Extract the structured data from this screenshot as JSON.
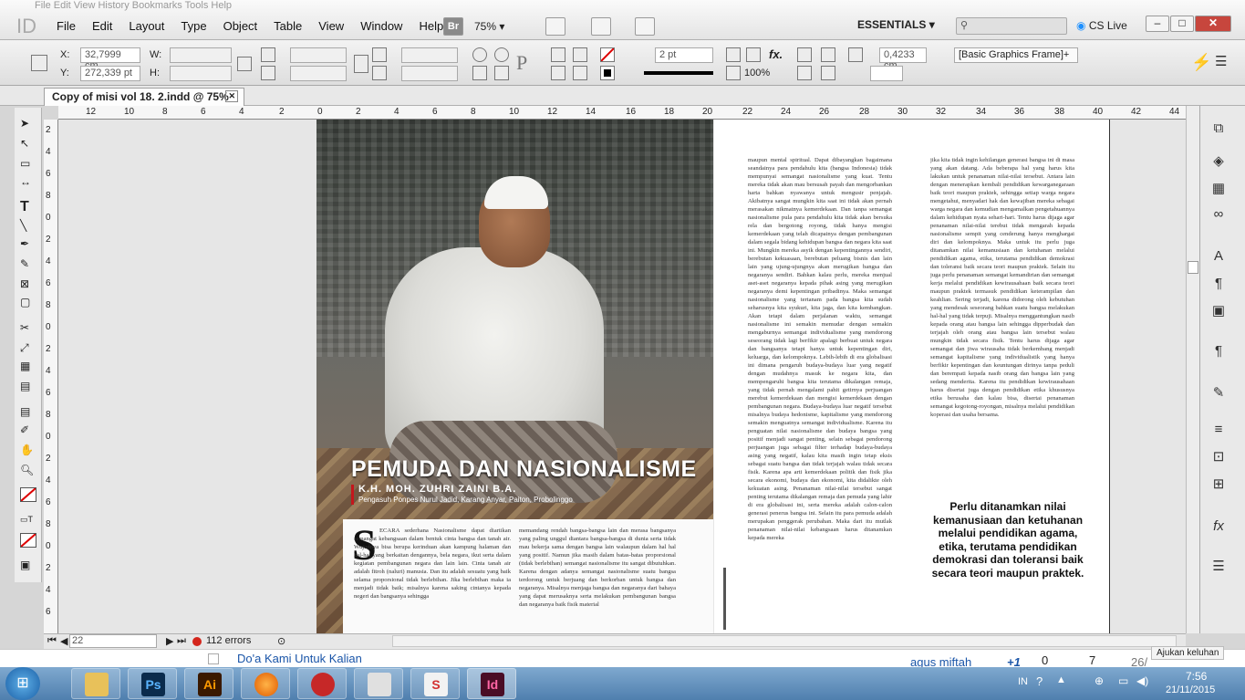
{
  "menubar": {
    "ghost_menu": "File   Edit   View   History   Bookmarks   Tools   Help",
    "app_logo": "ID",
    "items": [
      "File",
      "Edit",
      "Layout",
      "Type",
      "Object",
      "Table",
      "View",
      "Window",
      "Help"
    ],
    "bridge": "Br",
    "zoom": "75%",
    "workspace": "ESSENTIALS",
    "search_placeholder": "",
    "cs_live": "CS Live"
  },
  "control": {
    "x_label": "X:",
    "x_value": "32,7999 cm",
    "y_label": "Y:",
    "y_value": "272,339 pt",
    "w_label": "W:",
    "h_label": "H:",
    "stroke_weight": "2 pt",
    "scale_pct": "100%",
    "offset": "0,4233 cm",
    "frame_style": "[Basic Graphics Frame]+"
  },
  "document": {
    "tab_title": "Copy of misi vol 18. 2.indd @ 75%",
    "ruler_top": [
      "12",
      "10",
      "8",
      "6",
      "4",
      "2",
      "0",
      "2",
      "4",
      "6",
      "8",
      "10",
      "12",
      "14",
      "16",
      "18",
      "20",
      "22",
      "24",
      "26",
      "28",
      "30",
      "32",
      "34",
      "36",
      "38",
      "40",
      "42",
      "44"
    ],
    "ruler_left": [
      "2",
      "4",
      "6",
      "8",
      "0",
      "2",
      "4",
      "6",
      "8",
      "0",
      "2",
      "4",
      "6",
      "8",
      "0",
      "2",
      "4",
      "6",
      "8",
      "0",
      "2",
      "4",
      "6"
    ]
  },
  "article": {
    "headline": "PEMUDA DAN NASIONALISME",
    "author": "K.H. MOH. ZUHRI ZAINI B.A.",
    "author_role": "Pengasuh Ponpes Nurul Jadid, Karang Anyar, Paiton, Probolinggo",
    "dropcap": "S",
    "col1": "ECARA sederhana Nasionalisme dapat diartikan semangat kebangsaan dalam bentuk cinta bangsa dan tanah air. Wujudnya bisa berupa kerinduan akan kampung halaman dan hal-hal yang berkaitan dengannya, bela negara, ikut serta dalam kegiatan pembangunan negara dan lain lain. Cinta tanah air adalah fitroh (naluri) manusia. Dan itu adalah sesuatu yang baik selama proporsional tidak berlebihan. Jika berlebihan maka ia menjadi tidak baik; misalnya karena saking cintanya kepada negeri dan bangsanya sehingga",
    "col2": "memandang rendah bangsa-bangsa lain dan merasa bangsanya yang paling unggul diantara bangsa-bangsa di dunia serta tidak mau bekerja sama dengan bangsa lain walaupun dalam hal hal yang positif. Namun jika masih dalam batas-batas proporsional (tidak berlebihan) semangat nasionalisme itu sangat dibutuhkan. Karena dengan adanya semangat nasionalisme suatu bangsa terdorong untuk berjuang dan berkorban untuk bangsa dan negaranya. Misalnya menjaga bangsa dan negaranya dari bahaya yang dapat merusaknya serta melakukan pembangunan bangsa dan negaranya baik fisik material",
    "col3": "maupun mental spiritual. Dapat dibayangkan bagaimana seandainya para pendahulu kita (bangsa Indonesia) tidak mempunyai semangat nasionalisme yang kuat. Tentu mereka tidak akan mau bersusah payah dan mengorbankan harta bahkan nyawanya untuk mengusir penjajah. Akibatnya sangat mungkin kita saat ini tidak akan pernah merasakan nikmatnya kemerdekaan. Dan tanpa semangat nasionalisme pula para pendahulu kita tidak akan bersuka rela dan bergotong royong, tidak hanya mengisi kemerdekaan yang telah dicapainya dengan pembangunan dalam segala bidang kehidupan bangsa dan negara kita saat ini. Mungkin mereka asyik dengan kepentingannya sendiri, berebutan kekuasaan, berebutan peluang bisnis dan lain lain yang ujung-ujungnya akan merugikan bangsa dan negaranya sendiri. Bahkan kalau perlu, mereka menjual aset-aset negaranya kepada pihak asing yang merugikan negaranya demi kepentingan pribadinya. Maka semangat nasionalisme yang tertanam pada bangsa kita sudah seharusnya kita syukuri, kita jaga, dan kita kembangkan. Akan tetapi dalam perjalanan waktu, semangat nasionalisme ini semakin memudar dengan semakin mengaburnya semangat individualisme yang mendorong seseorang tidak lagi berfikir apalagi berbuat untuk negara dan bangsanya tetapi hanya untuk kepentingan diri, keluarga, dan kelompoknya. Lebih-lebih di era globalisasi ini dimana pengaruh budaya-budaya luar yang negatif dengan mudahnya masuk ke negara kita, dan mempengaruhi bangsa kita terutama dikalangan remaja, yang tidak pernah mengalami pahit getirnya perjuangan merebut kemerdekaan dan mengisi kemerdekaan dengan pembangunan negara. Budaya-budaya luar negatif tersebut misalnya budaya hedonisme, kapitalisme yang mendorong semakin menguatnya semangat individualisme. Karena itu penguatan nilai nasionalisme dan budaya bangsa yang positif menjadi sangat penting, selain sebagai pendorong perjuangan juga sebagai filter terhadap budaya-budaya asing yang negatif, kalau kita masih ingin tetap eksis sebagai suatu bangsa dan tidak terjajah walau tidak secara fisik. Karena apa arti kemerdekaan politik dan fisik jika secara ekonomi, budaya dan ekonomi, kita didalikte oleh kekuatan asing. Penanaman nilai-nilai tersebut sangat penting terutama dikalangan remaja dan pemuda yang lahir di era globalisasi ini, serta mereka adalah calon-calon generasi penerus bangsa ini. Selain itu para pemuda adalah merupakan penggerak perubahan. Maka dari itu mutlak penanaman nilai-nilai kebangsaan harus ditanamkan kepada mereka",
    "col4": "jika kita tidak ingin kehilangan generasi bangsa ini di masa yang akan datang. Ada beberapa hal yang harus kita lakukan untuk penanaman nilai-nilai tersebut. Antara lain dengan menerapkan kembali pendidikan kewarganegaraan baik teori maupun praktek, sehingga setiap warga negara mengetahui, menyadari hak dan kewajiban mereka sebagai warga negara dan kemudian mengamalkan pengetahuannya dalam kehidupan nyata sehari-hari. Tentu harus dijaga agar penanaman nilai-nilai terebut tidak mengarah kepada nasionalisme sempit yang cenderung hanya menghargai diri dan kelompoknya. Maka untuk itu perlu juga ditanamkan nilai kemanusiaan dan ketuhanan melalui pendidikan agama, etika, terutama pendidikan demokrasi dan toleransi baik secara teori maupun praktek. Selain itu juga perlu penanaman semangat kemandirian dan semangat kerja melalui pendidikan kewirausahaan baik secara teori maupun praktek termasuk pendidikan keterampilan dan keahlian. Sering terjadi, karena didorong oleh kebutuhan yang mendesak seseorang bahkan suatu bangsa melakukan hal-hal yang tidak terpuji. Misalnya menggantungkan nasib kepada orang atau bangsa lain sehingga dipperbudak dan terjajah oleh orang atau bangsa lain tersebut walau mungkin tidak secara fisik. Tentu harus dijaga agar semangat dan jiwa wirausaha tidak berkembang menjadi semangat kapitalisme yang individualistik yang hanya berfikir kepentingan dan keuntungan dirinya tanpa peduli dan berempati kepada nasib orang dan bangsa lain yang sedang menderita. Karena itu pendidikan kewirausahaan harus disertai juga dengan pendidikan etika khususnya etika berusaha dan kalau bisa, disertai penanaman semangat kegotong-royongan, misalnya melalui pendidikan koperasi dan usaha bersama.",
    "pull_quote": "Perlu ditanamkan nilai kemanusiaan dan ketuhanan melalui pendidikan agama, etika, terutama pendidikan demokrasi dan toleransi baik secara teori maupun praktek."
  },
  "status": {
    "page": "22",
    "errors": "112 errors"
  },
  "browser_strip": {
    "link_title": "Do'a Kami Untuk Kalian",
    "user": "agus miftah",
    "plus_one": "+1",
    "comments": "0",
    "shares": "7",
    "views": "26/",
    "hint": "Ajukan keluhan"
  },
  "taskbar": {
    "lang": "IN",
    "time": "7:56",
    "date": "21/11/2015",
    "apps": [
      "windows-explorer",
      "photoshop",
      "illustrator",
      "firefox",
      "ccleaner",
      "paint",
      "snagit",
      "indesign"
    ]
  },
  "colors": {
    "accent_red": "#c4161c",
    "indesign_pink": "#c2185b",
    "taskbar_blue": "#4f7fae"
  }
}
